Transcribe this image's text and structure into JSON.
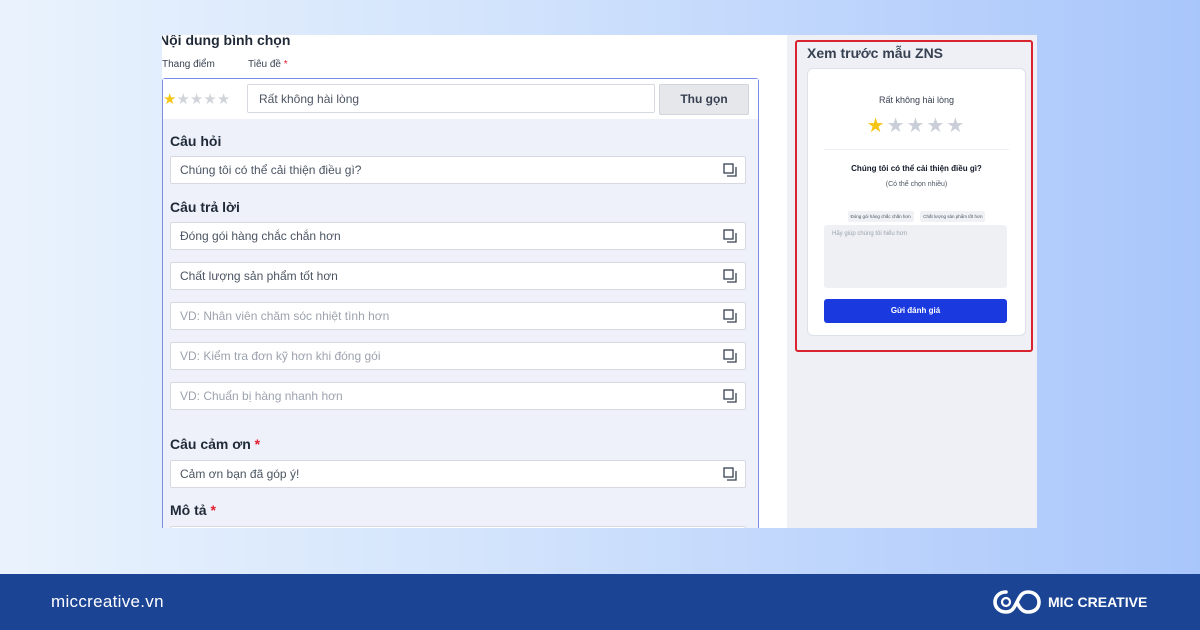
{
  "editor": {
    "section_title": "Nội dung bình chọn",
    "column_labels": {
      "rating": "Thang điểm",
      "title": "Tiêu đề",
      "required_mark": "*"
    },
    "rating_stars_filled": 1,
    "rating_stars_total": 5,
    "title_value": "Rất không hài lòng",
    "collapse_button": "Thu gọn",
    "question_label": "Câu hỏi",
    "question_value": "Chúng tôi có thể cải thiện điều gì?",
    "answers_label": "Câu trả lời",
    "answers": [
      {
        "value": "Đóng gói hàng chắc chắn hơn",
        "placeholder": false
      },
      {
        "value": "Chất lượng sản phẩm tốt hơn",
        "placeholder": false
      },
      {
        "value": "VD: Nhân viên chăm sóc nhiệt tình hơn",
        "placeholder": true
      },
      {
        "value": "VD: Kiểm tra đơn kỹ hơn khi đóng gói",
        "placeholder": true
      },
      {
        "value": "VD: Chuẩn bị hàng nhanh hơn",
        "placeholder": true
      }
    ],
    "thanks_label": "Câu cảm ơn",
    "thanks_value": "Cảm ơn bạn đã góp ý!",
    "description_label": "Mô tả",
    "required_mark": "*"
  },
  "preview": {
    "title": "Xem trước mẫu ZNS",
    "rating_text": "Rất không hài lòng",
    "stars_filled": 1,
    "stars_total": 5,
    "question": "Chúng tôi có thể cải thiện điều gì?",
    "hint": "(Có thể chọn nhiều)",
    "chips": [
      "Đóng gói hàng chắc chắn hơn",
      "Chất lượng sản phẩm tốt hơn"
    ],
    "textarea_placeholder": "Hãy giúp chúng tôi hiểu hơn",
    "submit_button": "Gửi đánh giá",
    "frame_color": "#d9232e",
    "submit_color": "#1a3ae0"
  },
  "footer": {
    "url": "miccreative.vn",
    "brand": "MIC CREATIVE",
    "background": "#1b4494"
  }
}
